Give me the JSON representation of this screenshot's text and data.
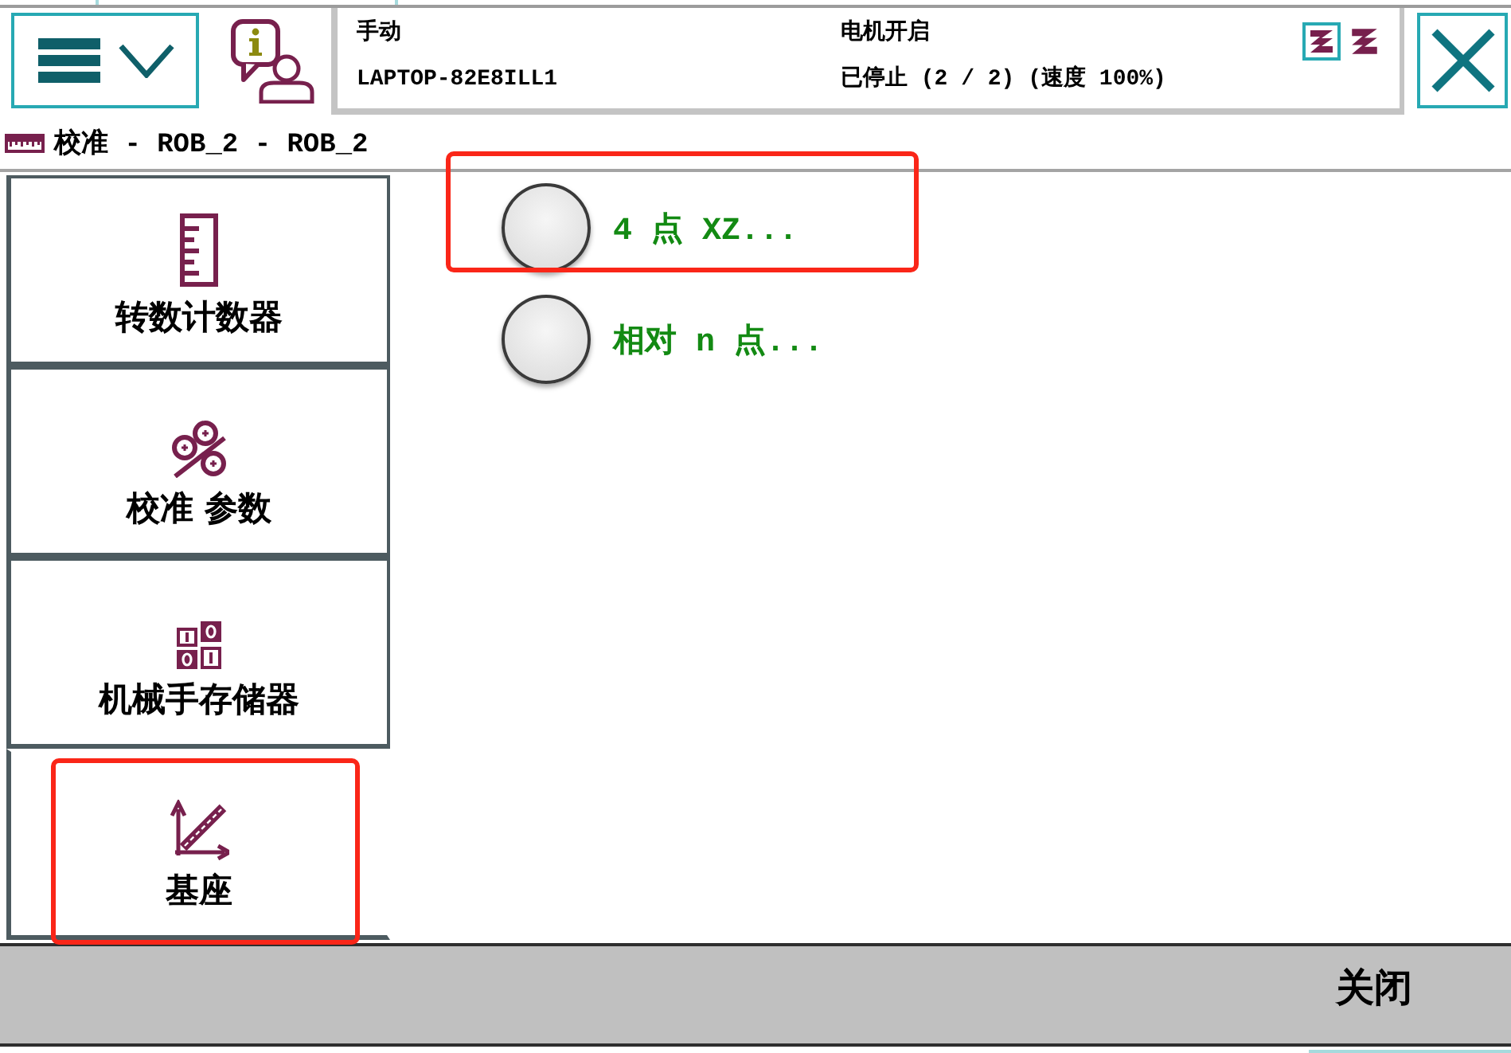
{
  "header": {
    "status": {
      "mode": "手动",
      "controller": "LAPTOP-82E8ILL1",
      "motors": "电机开启",
      "program_state": "已停止 (2 / 2) (速度 100%)"
    },
    "units": [
      {
        "selected": true
      },
      {
        "selected": false
      }
    ]
  },
  "window": {
    "title": "校准 - ROB_2 - ROB_2"
  },
  "sidebar": {
    "items": [
      {
        "label": "转数计数器",
        "selected": false,
        "highlighted": false
      },
      {
        "label": "校准 参数",
        "selected": false,
        "highlighted": false
      },
      {
        "label": "机械手存储器",
        "selected": false,
        "highlighted": false
      },
      {
        "label": "基座",
        "selected": true,
        "highlighted": true
      }
    ]
  },
  "options": [
    {
      "label": "4 点 XZ...",
      "selected": false,
      "highlighted": true
    },
    {
      "label": "相对 n 点...",
      "selected": false,
      "highlighted": false
    }
  ],
  "footer": {
    "buttons": [
      "关闭"
    ]
  }
}
